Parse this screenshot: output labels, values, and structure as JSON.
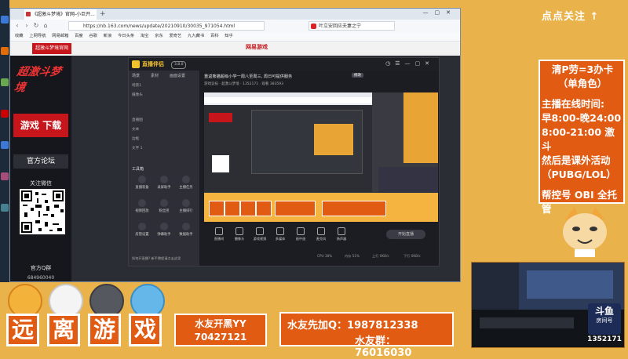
{
  "browser": {
    "tab_title": "《超激斗梦境》官网-小巨开...",
    "url": "https://nb.163.com/news/update/20210910/30035_971054.html",
    "search_text": "叶立安回应夫妻之宁",
    "bookmarks": [
      "收藏",
      "上网导航",
      "网易邮箱",
      "百度",
      "谷歌",
      "新浪",
      "今日头条",
      "淘宝",
      "京东",
      "爱奇艺",
      "九九藏书",
      "百科",
      "知乎"
    ]
  },
  "site": {
    "header_button": "超激斗梦境官网",
    "brand": "网易游戏",
    "game_logo": "超激斗梦境",
    "download": "游戏 下载",
    "forum": "官方论坛",
    "weixin_label": "关注微信",
    "qq_label": "官方Q群",
    "qq_number": "684960040"
  },
  "live_app": {
    "app_name": "直播伴侣",
    "version": "3.8.0",
    "side_tabs": [
      "场景",
      "素材",
      "画面设置"
    ],
    "scenes": [
      "场景1",
      "摄像头",
      "直播图",
      "文本",
      "边框",
      "文字 1"
    ],
    "tools_title": "工具箱",
    "tools": [
      {
        "label": "直播装备"
      },
      {
        "label": "录屏助手"
      },
      {
        "label": "主播任务"
      },
      {
        "label": "视频回放"
      },
      {
        "label": "粉丝团"
      },
      {
        "label": "主播排行"
      },
      {
        "label": "房管设置"
      },
      {
        "label": "弹幕助手"
      },
      {
        "label": "数据助手"
      }
    ],
    "footer_note": "如何开直播? 新手教程请点击这里",
    "stream_title": "重返熊猫超级小学一周八至周三,  周日可提供服务",
    "stream_badge": "修改",
    "stream_meta": "游戏竞技 · 超激斗梦境 · 1352171 · 观看 383593",
    "controls": [
      "直播间",
      "摄像头",
      "游戏视频",
      "多媒体",
      "画中画",
      "麦克风",
      "扬声器"
    ],
    "start_button": "开始直播",
    "bottom_status": [
      "CPU 38%",
      "内存 51%",
      "上行 0KB/s",
      "下行 0KB/s"
    ]
  },
  "overlay": {
    "tiles": [
      "远",
      "离",
      "游",
      "戏"
    ],
    "info1_line1": "水友开黑YY",
    "info1_line2": "70427121",
    "info2_line1": "水友先加Q：1987812338",
    "info2_line2": "水友群：76016030",
    "follow": "点点关注 ↑",
    "notice": {
      "line1": "清P劳=3办卡",
      "line2": "（单角色）",
      "line3": "主播在线时间:",
      "line4": "早8:00-晚24:00",
      "line5": "8:00-21:00 激斗",
      "line6": "然后是课外活动",
      "line7": "（PUBG/LOL）",
      "line8": "帮控号 OBI 全托管"
    },
    "room_title": "斗鱼",
    "room_sub": "房间号",
    "room_number": "1352171"
  },
  "colors": {
    "background": "#e9b24a",
    "tile_orange": "#e25b13",
    "game_red": "#c6161c",
    "app_yellow": "#f2c12e"
  }
}
